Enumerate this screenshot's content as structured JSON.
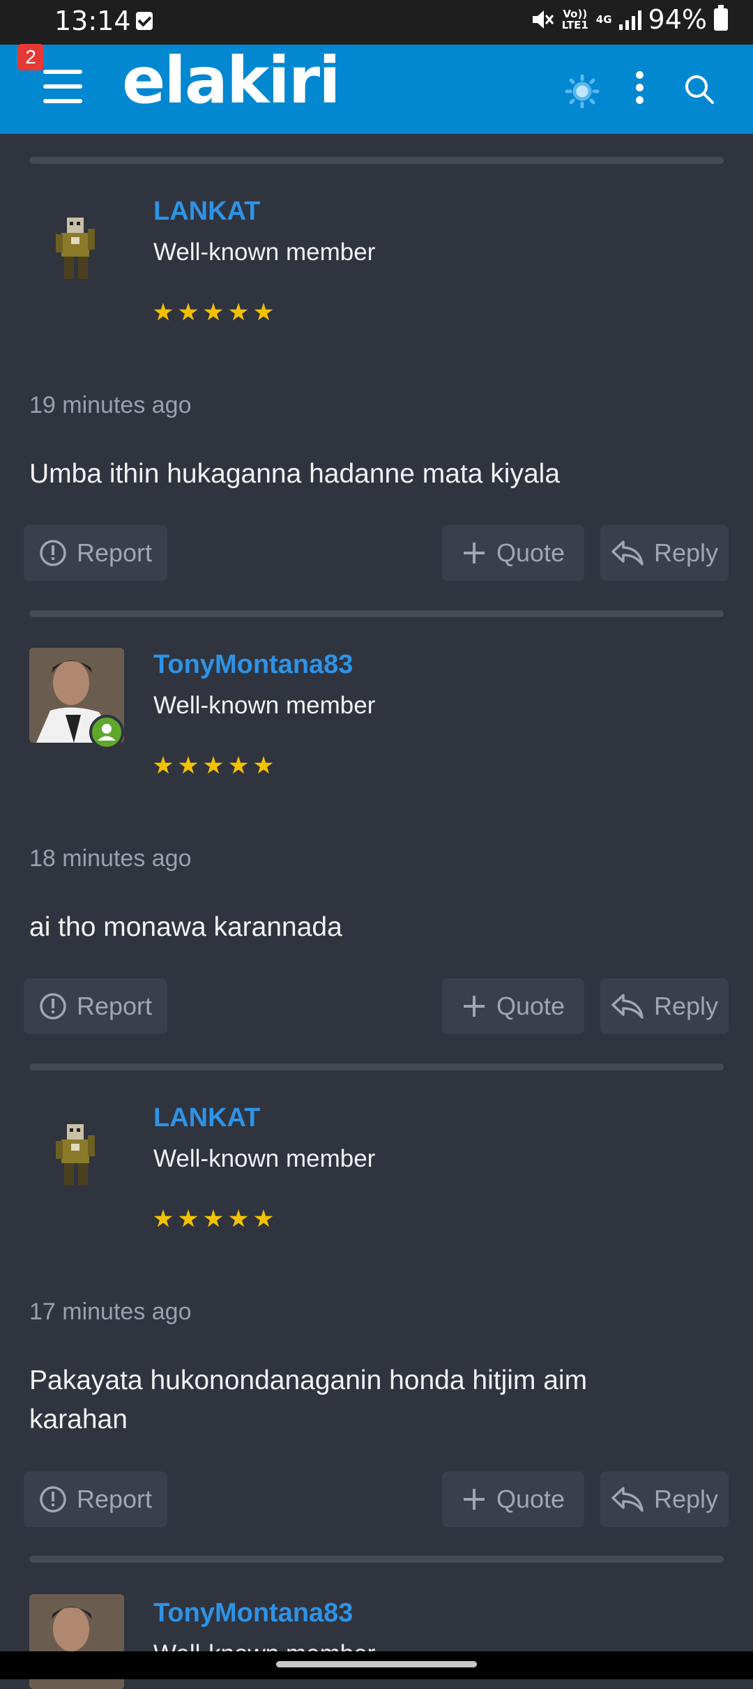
{
  "status_bar": {
    "time": "13:14",
    "volte": "Vo)) LTE1",
    "network": "4G",
    "battery": "94%"
  },
  "app_bar": {
    "notification_count": "2",
    "logo": "elakiri"
  },
  "posts": [
    {
      "username": "LANKAT",
      "role": "Well-known member",
      "stars": 5,
      "time": "19 minutes ago",
      "content": "Umba ithin hukaganna hadanne mata kiyala",
      "avatar": "pixel-character",
      "online": false
    },
    {
      "username": "TonyMontana83",
      "role": "Well-known member",
      "stars": 5,
      "time": "18 minutes ago",
      "content": "ai tho monawa karannada",
      "avatar": "photo",
      "online": true
    },
    {
      "username": "LANKAT",
      "role": "Well-known member",
      "stars": 5,
      "time": "17 minutes ago",
      "content": "Pakayata hukonondanaganin honda hitjim aim karahan",
      "avatar": "pixel-character",
      "online": false
    },
    {
      "username": "TonyMontana83",
      "role": "Well-known member",
      "avatar": "photo",
      "online": true
    }
  ],
  "actions": {
    "report": "Report",
    "quote": "Quote",
    "reply": "Reply"
  },
  "colors": {
    "app_bar": "#0288d1",
    "background": "#30343f",
    "username": "#2e93e6",
    "star": "#f2c200",
    "online": "#5fa82b"
  }
}
